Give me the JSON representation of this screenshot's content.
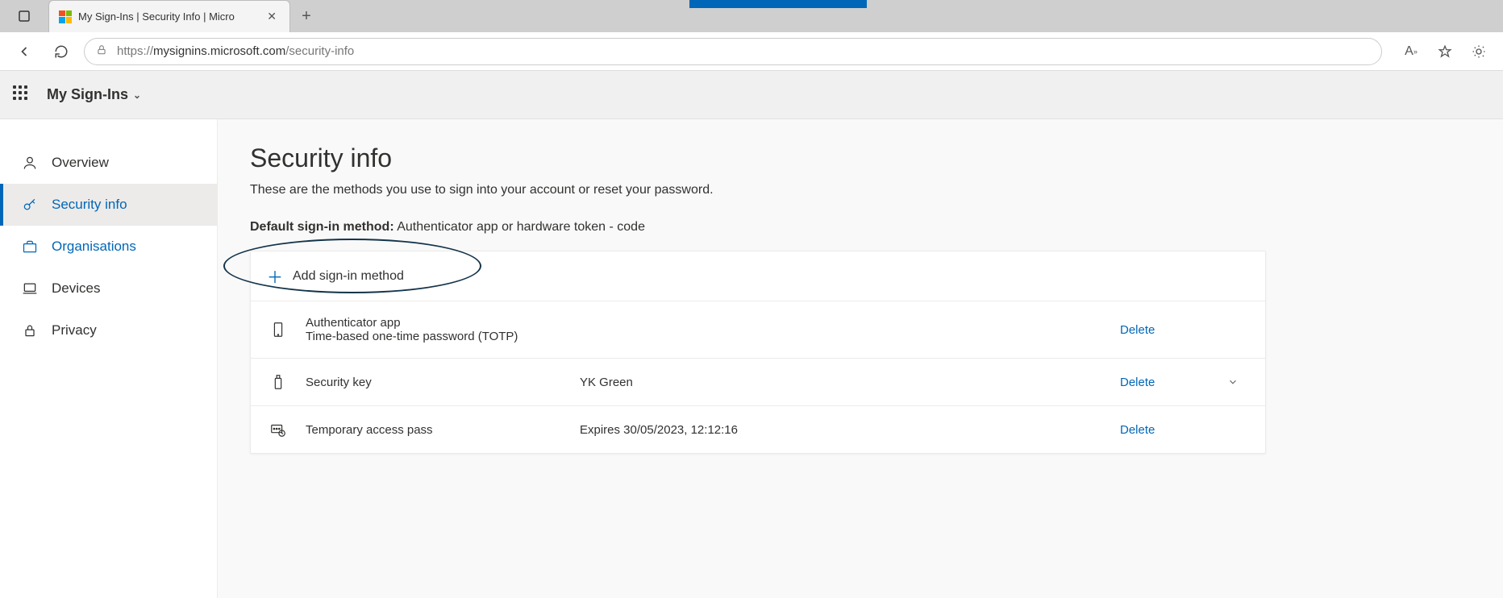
{
  "browser": {
    "tab_title": "My Sign-Ins | Security Info | Micro",
    "url_prefix": "https://",
    "url_host": "mysignins.microsoft.com",
    "url_path": "/security-info"
  },
  "header": {
    "app_title": "My Sign-Ins"
  },
  "sidebar": {
    "items": [
      {
        "label": "Overview"
      },
      {
        "label": "Security info"
      },
      {
        "label": "Organisations"
      },
      {
        "label": "Devices"
      },
      {
        "label": "Privacy"
      }
    ]
  },
  "page": {
    "title": "Security info",
    "subtitle": "These are the methods you use to sign into your account or reset your password.",
    "default_label": "Default sign-in method:",
    "default_value": "Authenticator app or hardware token - code",
    "add_label": "Add sign-in method",
    "methods": [
      {
        "name": "Authenticator app",
        "sub": "Time-based one-time password (TOTP)",
        "detail": "",
        "action": "Delete",
        "expandable": false
      },
      {
        "name": "Security key",
        "sub": "",
        "detail": "YK Green",
        "action": "Delete",
        "expandable": true
      },
      {
        "name": "Temporary access pass",
        "sub": "",
        "detail": "Expires 30/05/2023, 12:12:16",
        "action": "Delete",
        "expandable": false
      }
    ]
  }
}
